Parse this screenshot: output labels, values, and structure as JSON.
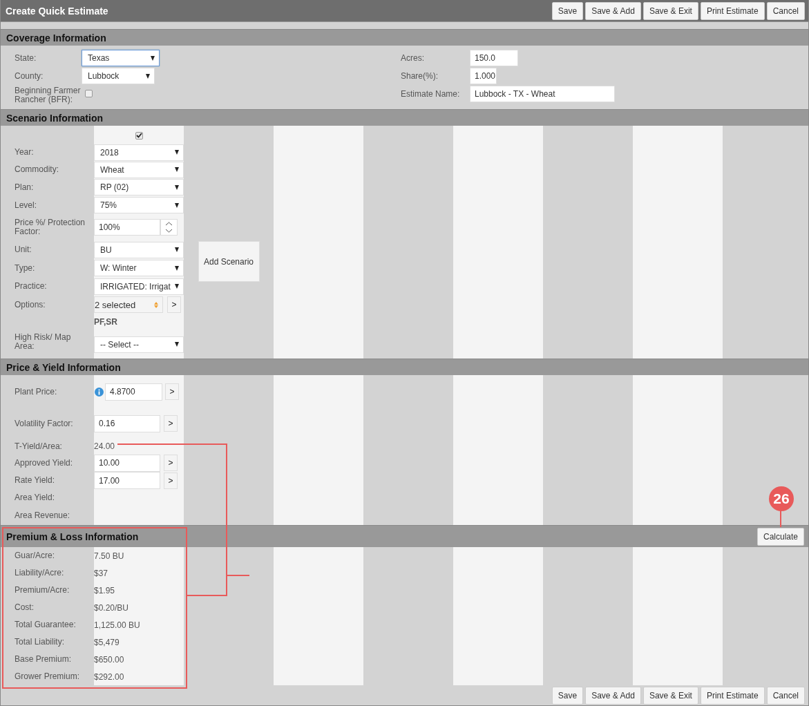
{
  "window": {
    "title": "Create Quick Estimate"
  },
  "top_buttons": [
    "Save",
    "Save & Add",
    "Save & Exit",
    "Print Estimate",
    "Cancel"
  ],
  "coverage": {
    "title": "Coverage Information",
    "left": [
      {
        "kind": "select",
        "label": "State:",
        "value": "Texas",
        "focused": true
      },
      {
        "kind": "select",
        "label": "County:",
        "value": "Lubbock",
        "focused": false
      },
      {
        "kind": "checkbox",
        "label": "Beginning Farmer Rancher (BFR):",
        "checked": false
      }
    ],
    "right": [
      {
        "label": "Acres:",
        "value": "150.0"
      },
      {
        "label": "Share(%):",
        "value": "1.000"
      },
      {
        "label": "Estimate Name:",
        "value": "Lubbock - TX - Wheat"
      }
    ]
  },
  "scenario": {
    "title": "Scenario Information",
    "include_checked": true,
    "add_button": "Add Scenario",
    "fields": [
      {
        "kind": "select",
        "label": "Year:",
        "value": "2018"
      },
      {
        "kind": "select",
        "label": "Commodity:",
        "value": "Wheat"
      },
      {
        "kind": "select",
        "label": "Plan:",
        "value": "RP (02)"
      },
      {
        "kind": "select",
        "label": "Level:",
        "value": "75%"
      },
      {
        "kind": "spinner",
        "label": "Price %/ Protection Factor:",
        "value": "100%"
      },
      {
        "kind": "select",
        "label": "Unit:",
        "value": "BU"
      },
      {
        "kind": "select",
        "label": "Type:",
        "value": "W: Winter"
      },
      {
        "kind": "select",
        "label": "Practice:",
        "value": "IRRIGATED: Irrigat"
      },
      {
        "kind": "multiselect",
        "label": "Options:",
        "value": "2 selected",
        "button": ">",
        "note": "PF,SR"
      },
      {
        "kind": "select",
        "label": "High Risk/ Map Area:",
        "value": "-- Select --"
      }
    ]
  },
  "price_yield": {
    "title": "Price & Yield Information",
    "fields": [
      {
        "kind": "input",
        "label": "Plant Price:",
        "value": "4.8700",
        "info": true,
        "button": ">"
      },
      {
        "kind": "input",
        "label": "Volatility Factor:",
        "value": "0.16",
        "info": false,
        "button": ">"
      },
      {
        "kind": "text",
        "label": "T-Yield/Area:",
        "value": "24.00"
      },
      {
        "kind": "input",
        "label": "Approved Yield:",
        "value": "10.00",
        "info": false,
        "button": ">"
      },
      {
        "kind": "input",
        "label": "Rate Yield:",
        "value": "17.00",
        "info": false,
        "button": ">"
      },
      {
        "kind": "text",
        "label": "Area Yield:"
      },
      {
        "kind": "text",
        "label": "Area Revenue:"
      }
    ]
  },
  "premium_loss": {
    "title": "Premium & Loss Information",
    "calculate_button": "Calculate",
    "rows": [
      {
        "label": "Guar/Acre:",
        "value": "7.50 BU"
      },
      {
        "label": "Liability/Acre:",
        "value": "$37"
      },
      {
        "label": "Premium/Acre:",
        "value": "$1.95"
      },
      {
        "label": "Cost:",
        "value": "$0.20/BU"
      },
      {
        "label": "Total Guarantee:",
        "value": "1,125.00 BU"
      },
      {
        "label": "Total Liability:",
        "value": "$5,479"
      },
      {
        "label": "Base Premium:",
        "value": "$650.00"
      },
      {
        "label": "Grower Premium:",
        "value": "$292.00"
      }
    ]
  },
  "annotation": {
    "badge": "26"
  },
  "bottom_buttons": [
    "Save",
    "Save & Add",
    "Save & Exit",
    "Print Estimate",
    "Cancel"
  ]
}
